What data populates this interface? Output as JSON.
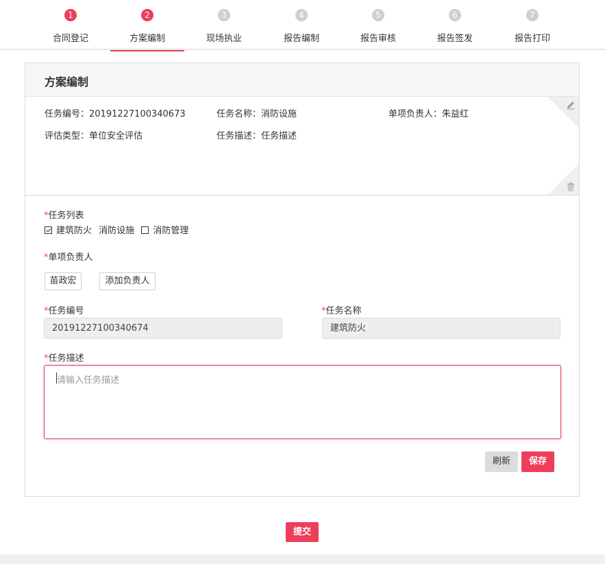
{
  "steps": [
    {
      "num": "1",
      "label": "合同登记"
    },
    {
      "num": "2",
      "label": "方案编制"
    },
    {
      "num": "3",
      "label": "现场执业"
    },
    {
      "num": "4",
      "label": "报告编制"
    },
    {
      "num": "5",
      "label": "报告审核"
    },
    {
      "num": "6",
      "label": "报告签发"
    },
    {
      "num": "7",
      "label": "报告打印"
    }
  ],
  "card": {
    "title": "方案编制"
  },
  "info": {
    "task_no": "任务编号：20191227100340673",
    "task_name": "任务名称：消防设施",
    "owner": "单项负责人：朱益红",
    "eval_type": "评估类型：单位安全评估",
    "task_desc": "任务描述：任务描述"
  },
  "form": {
    "required_mark": "*",
    "task_list_label": "任务列表",
    "task_list": [
      {
        "label": "建筑防火",
        "checked": true
      },
      {
        "label": "消防设施",
        "checked": null
      },
      {
        "label": "消防管理",
        "checked": false
      }
    ],
    "owner_label": "单项负责人",
    "owner_chip": "苗政宏",
    "add_owner": "添加负责人",
    "task_no_label": "任务编号",
    "task_no_value": "20191227100340674",
    "task_name_label": "任务名称",
    "task_name_value": "建筑防火",
    "desc_label": "任务描述",
    "desc_placeholder": "请输入任务描述",
    "refresh": "刷新",
    "save": "保存"
  },
  "submit": "提交",
  "colors": {
    "accent": "#ee3e5a",
    "inactive_step": "#cfcfcf"
  },
  "active_step": 2
}
